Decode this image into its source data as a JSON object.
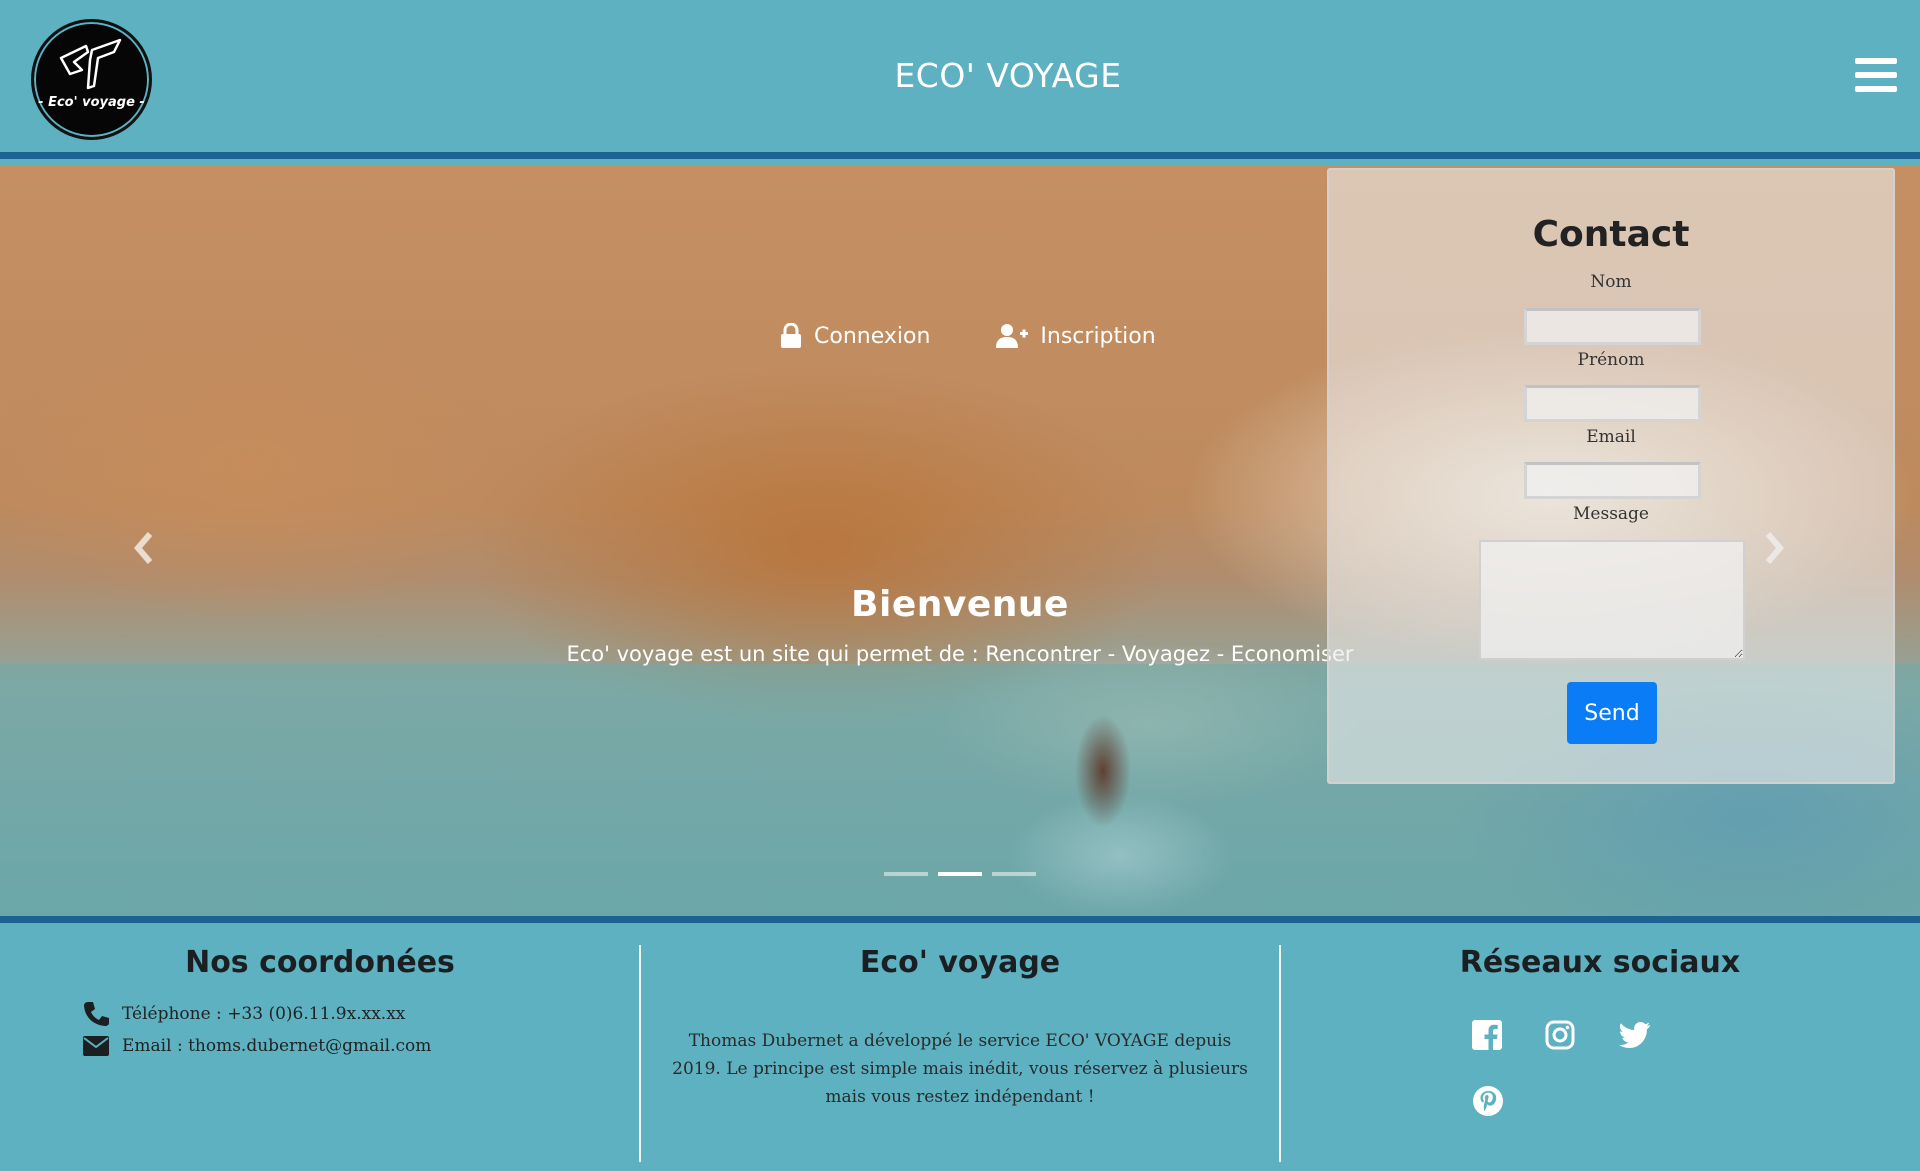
{
  "header": {
    "logo_text": "- Eco' voyage -",
    "site_title": "ECO' VOYAGE",
    "menu_icon": "hamburger-menu-icon"
  },
  "hero": {
    "links": [
      {
        "label": "Connexion",
        "icon": "lock-icon"
      },
      {
        "label": "Inscription",
        "icon": "user-plus-icon"
      }
    ],
    "slide_title": "Bienvenue",
    "slide_caption": "Eco' voyage est un site qui permet de : Rencontrer - Voyagez - Economiser",
    "active_slide": 2,
    "slide_count": 3
  },
  "contact": {
    "title": "Contact",
    "fields": [
      {
        "label": "Nom",
        "value": ""
      },
      {
        "label": "Prénom",
        "value": ""
      },
      {
        "label": "Email",
        "value": ""
      }
    ],
    "message_label": "Message",
    "message_value": "",
    "send_label": "Send"
  },
  "footer": {
    "coordinates": {
      "title": "Nos coordonées",
      "phone": "Téléphone : +33 (0)6.11.9x.xx.xx",
      "email": "Email : thoms.dubernet@gmail.com"
    },
    "about": {
      "title": "Eco' voyage",
      "text": "Thomas Dubernet a développé le service ECO' VOYAGE depuis 2019. Le principe est simple mais inédit, vous réservez à plusieurs mais vous restez indépendant !"
    },
    "social": {
      "title": "Réseaux sociaux",
      "icons": [
        "facebook-icon",
        "instagram-icon",
        "twitter-icon",
        "pinterest-icon"
      ]
    }
  },
  "colors": {
    "header_bg": "#5db1c1",
    "accent_border": "#1d6391",
    "send_button": "#0a7cf6"
  }
}
